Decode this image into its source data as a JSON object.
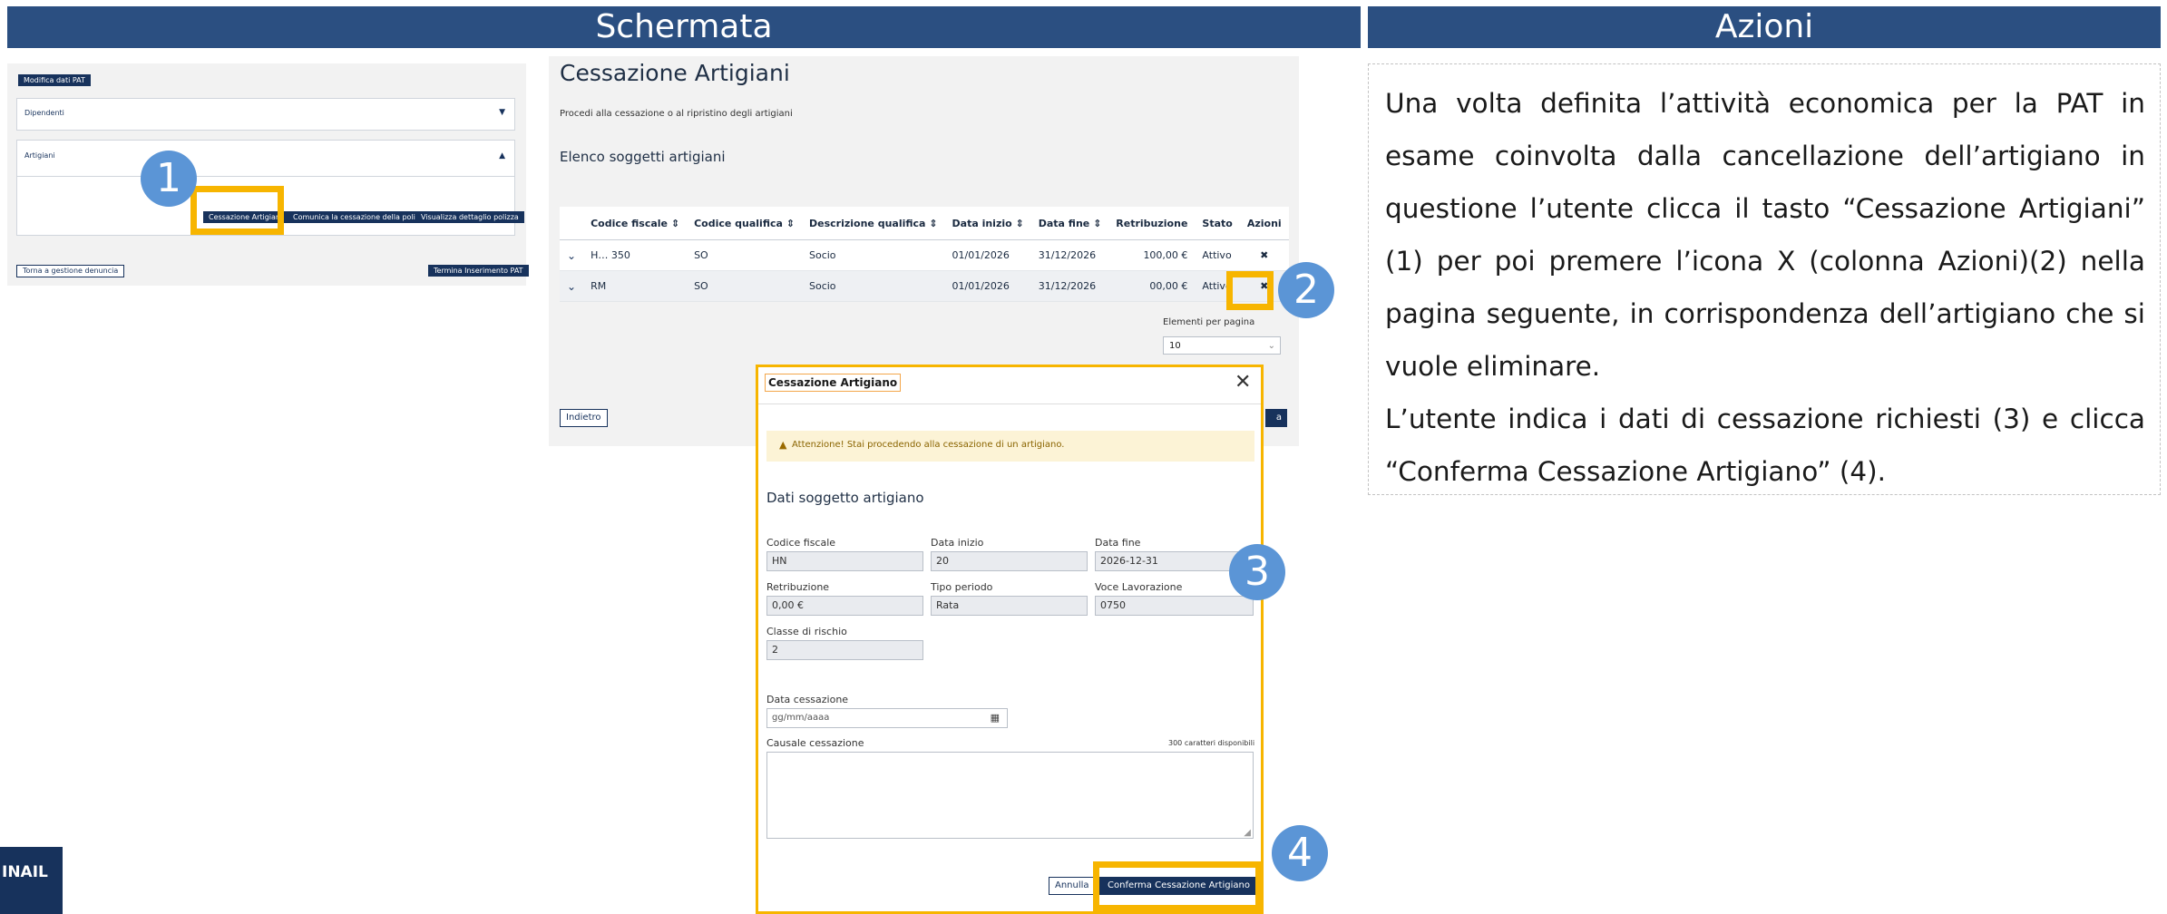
{
  "headers": {
    "left": "Schermata",
    "right": "Azioni"
  },
  "screen1": {
    "modifica_btn": "Modifica dati PAT",
    "dipendenti": "Dipendenti",
    "artigiani": "Artigiani",
    "btn_cessazione": "Cessazione Artigiani",
    "btn_comunica": "Comunica la cessazione della polizza",
    "btn_visualizza": "Visualizza dettaglio polizza",
    "torna": "Torna a gestione denuncia",
    "termina": "Termina Inserimento PAT"
  },
  "screen2": {
    "title": "Cessazione Artigiani",
    "subtitle": "Procedi alla cessazione o al ripristino degli artigiani",
    "section": "Elenco soggetti artigiani",
    "columns": [
      "Codice fiscale ⇕",
      "Codice qualifica ⇕",
      "Descrizione qualifica ⇕",
      "Data inizio ⇕",
      "Data fine ⇕",
      "Retribuzione",
      "Stato",
      "Azioni"
    ],
    "rows": [
      {
        "cf": "H…          350",
        "cq": "SO",
        "dq": "Socio",
        "di": "01/01/2026",
        "df": "31/12/2026",
        "ret": "100,00 €",
        "stato": "Attivo",
        "az": "✖"
      },
      {
        "cf": "RM",
        "cq": "SO",
        "dq": "Socio",
        "di": "01/01/2026",
        "df": "31/12/2026",
        "ret": "00,00 €",
        "stato": "Attivo",
        "az": "✖"
      }
    ],
    "per_page_label": "Elementi per pagina",
    "per_page_value": "10",
    "indietro": "Indietro",
    "right_btn_fragment": "a"
  },
  "modal": {
    "title": "Cessazione Artigiano",
    "warning": "Attenzione! Stai procedendo alla cessazione di un artigiano.",
    "section": "Dati soggetto artigiano",
    "cf_label": "Codice fiscale",
    "cf_value": "HN",
    "di_label": "Data inizio",
    "di_value": "20",
    "df_label": "Data fine",
    "df_value": "2026-12-31",
    "ret_label": "Retribuzione",
    "ret_value": "0,00 €",
    "tp_label": "Tipo periodo",
    "tp_value": "Rata",
    "vl_label": "Voce Lavorazione",
    "vl_value": "0750",
    "cr_label": "Classe di rischio",
    "cr_value": "2",
    "dc_label": "Data cessazione",
    "dc_placeholder": "gg/mm/aaaa",
    "cc_label": "Causale cessazione",
    "cc_counter": "300 caratteri disponibili",
    "annulla": "Annulla",
    "conferma": "Conferma Cessazione Artigiano"
  },
  "badges": [
    "1",
    "2",
    "3",
    "4"
  ],
  "description": [
    "Una volta definita l’attività economica per la PAT in esame coinvolta dalla cancellazione dell’artigiano in questione l’utente clicca il tasto “Cessazione Artigiani” (1) per poi premere l’icona X (colonna Azioni)(2) nella pagina seguente, in corrispondenza dell’artigiano che si vuole eliminare.",
    "L’utente indica i dati di cessazione richiesti (3) e clicca “Conferma Cessazione Artigiano” (4)."
  ],
  "logo": "INAIL",
  "colors": {
    "header": "#2b4f81",
    "highlight": "#f7b500",
    "badge": "#5b95d6",
    "navy": "#17325c"
  }
}
